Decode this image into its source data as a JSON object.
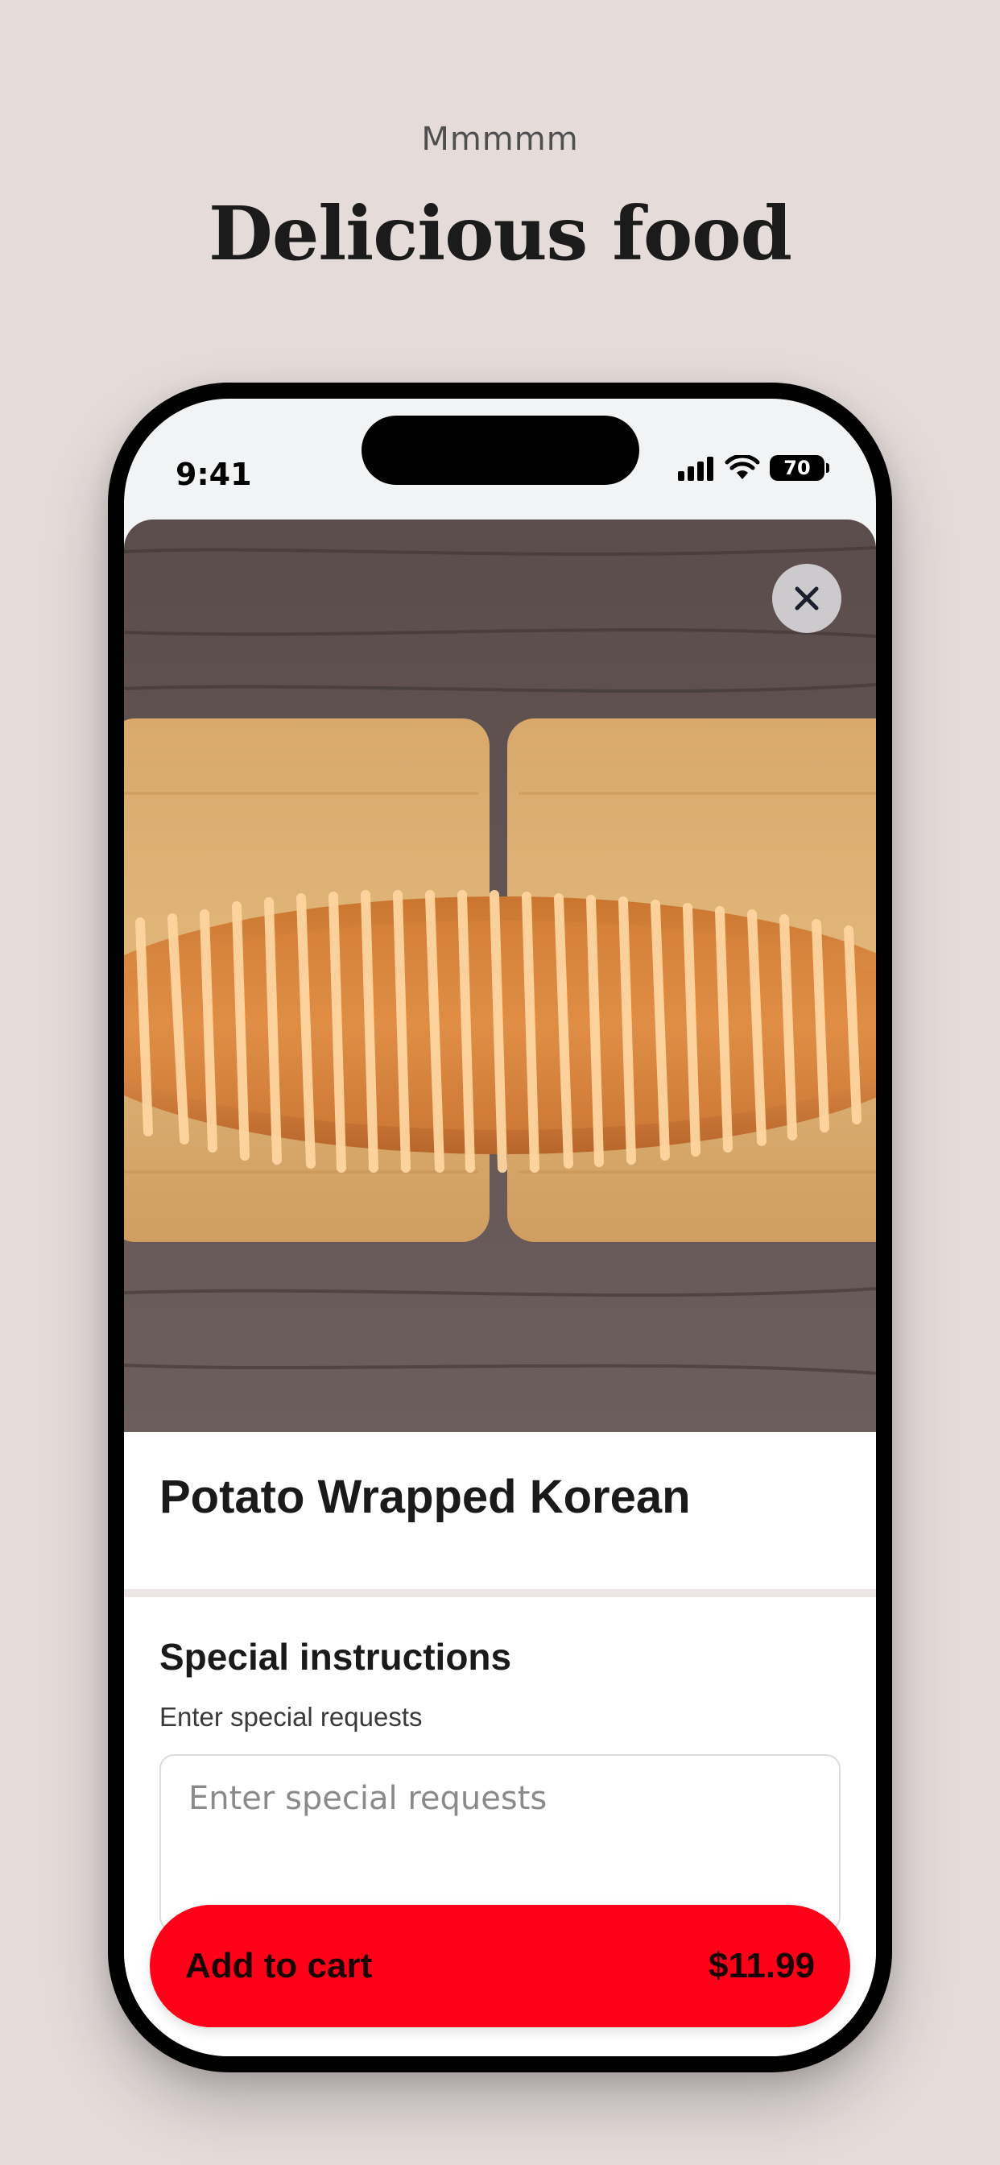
{
  "header": {
    "eyebrow": "Mmmmm",
    "headline": "Delicious food"
  },
  "status_bar": {
    "time": "9:41",
    "battery": "70",
    "icons": [
      "cellular-signal-icon",
      "wifi-icon",
      "battery-icon"
    ]
  },
  "item": {
    "image": "potato-wrapped-korean-corn-dog-photo",
    "title": "Potato Wrapped Korean"
  },
  "special_instructions": {
    "title": "Special instructions",
    "subtitle": "Enter special requests",
    "placeholder": "Enter special requests",
    "value": ""
  },
  "cart_button": {
    "label": "Add to cart",
    "price": "$11.99"
  },
  "colors": {
    "background": "#e5dcda",
    "accent": "#ff0019"
  }
}
